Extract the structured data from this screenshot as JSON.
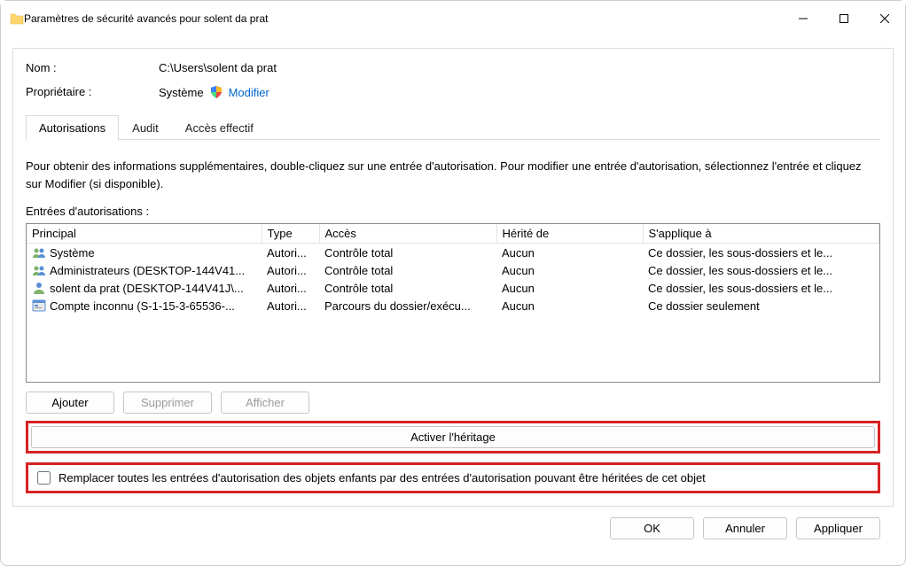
{
  "window": {
    "title": "Paramètres de sécurité avancés pour solent da prat"
  },
  "info": {
    "name_label": "Nom :",
    "name_value": "C:\\Users\\solent da prat",
    "owner_label": "Propriétaire :",
    "owner_value": "Système",
    "modify_link": "Modifier"
  },
  "tabs": {
    "permissions": "Autorisations",
    "audit": "Audit",
    "effective": "Accès effectif"
  },
  "instructions": "Pour obtenir des informations supplémentaires, double-cliquez sur une entrée d'autorisation. Pour modifier une entrée d'autorisation, sélectionnez l'entrée et cliquez sur Modifier (si disponible).",
  "entries_label": "Entrées d'autorisations :",
  "columns": {
    "principal": "Principal",
    "type": "Type",
    "access": "Accès",
    "inherited": "Hérité de",
    "applies": "S'applique à"
  },
  "rows": [
    {
      "icon": "group",
      "principal": "Système",
      "type": "Autori...",
      "access": "Contrôle total",
      "inherited": "Aucun",
      "applies": "Ce dossier, les sous-dossiers et le..."
    },
    {
      "icon": "group",
      "principal": "Administrateurs (DESKTOP-144V41...",
      "type": "Autori...",
      "access": "Contrôle total",
      "inherited": "Aucun",
      "applies": "Ce dossier, les sous-dossiers et le..."
    },
    {
      "icon": "user",
      "principal": "solent da prat (DESKTOP-144V41J\\...",
      "type": "Autori...",
      "access": "Contrôle total",
      "inherited": "Aucun",
      "applies": "Ce dossier, les sous-dossiers et le..."
    },
    {
      "icon": "app",
      "principal": "Compte inconnu (S-1-15-3-65536-...",
      "type": "Autori...",
      "access": "Parcours du dossier/exécu...",
      "inherited": "Aucun",
      "applies": "Ce dossier seulement"
    }
  ],
  "buttons": {
    "add": "Ajouter",
    "remove": "Supprimer",
    "view": "Afficher",
    "enable_inherit": "Activer l'héritage",
    "replace_children": "Remplacer toutes les entrées d'autorisation des objets enfants par des entrées d'autorisation pouvant être héritées de cet objet",
    "ok": "OK",
    "cancel": "Annuler",
    "apply": "Appliquer"
  }
}
